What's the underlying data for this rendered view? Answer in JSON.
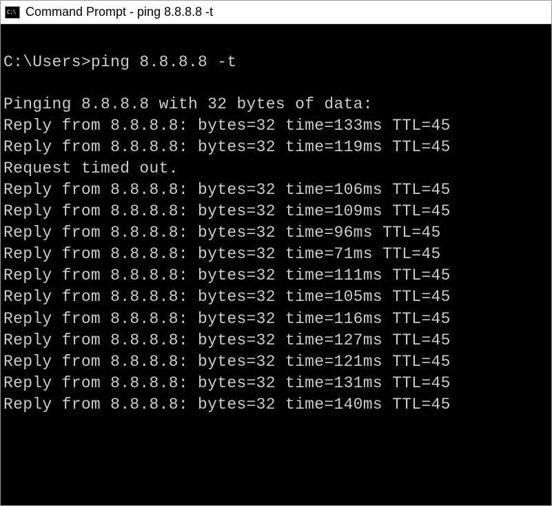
{
  "window": {
    "icon_label": "C:\\",
    "title": "Command Prompt - ping  8.8.8.8 -t"
  },
  "terminal": {
    "prompt": "C:\\Users>",
    "command": "ping 8.8.8.8 -t",
    "header": "Pinging 8.8.8.8 with 32 bytes of data:",
    "lines": [
      "Reply from 8.8.8.8: bytes=32 time=133ms TTL=45",
      "Reply from 8.8.8.8: bytes=32 time=119ms TTL=45",
      "Request timed out.",
      "Reply from 8.8.8.8: bytes=32 time=106ms TTL=45",
      "Reply from 8.8.8.8: bytes=32 time=109ms TTL=45",
      "Reply from 8.8.8.8: bytes=32 time=96ms TTL=45",
      "Reply from 8.8.8.8: bytes=32 time=71ms TTL=45",
      "Reply from 8.8.8.8: bytes=32 time=111ms TTL=45",
      "Reply from 8.8.8.8: bytes=32 time=105ms TTL=45",
      "Reply from 8.8.8.8: bytes=32 time=116ms TTL=45",
      "Reply from 8.8.8.8: bytes=32 time=127ms TTL=45",
      "Reply from 8.8.8.8: bytes=32 time=121ms TTL=45",
      "Reply from 8.8.8.8: bytes=32 time=131ms TTL=45",
      "Reply from 8.8.8.8: bytes=32 time=140ms TTL=45"
    ]
  }
}
